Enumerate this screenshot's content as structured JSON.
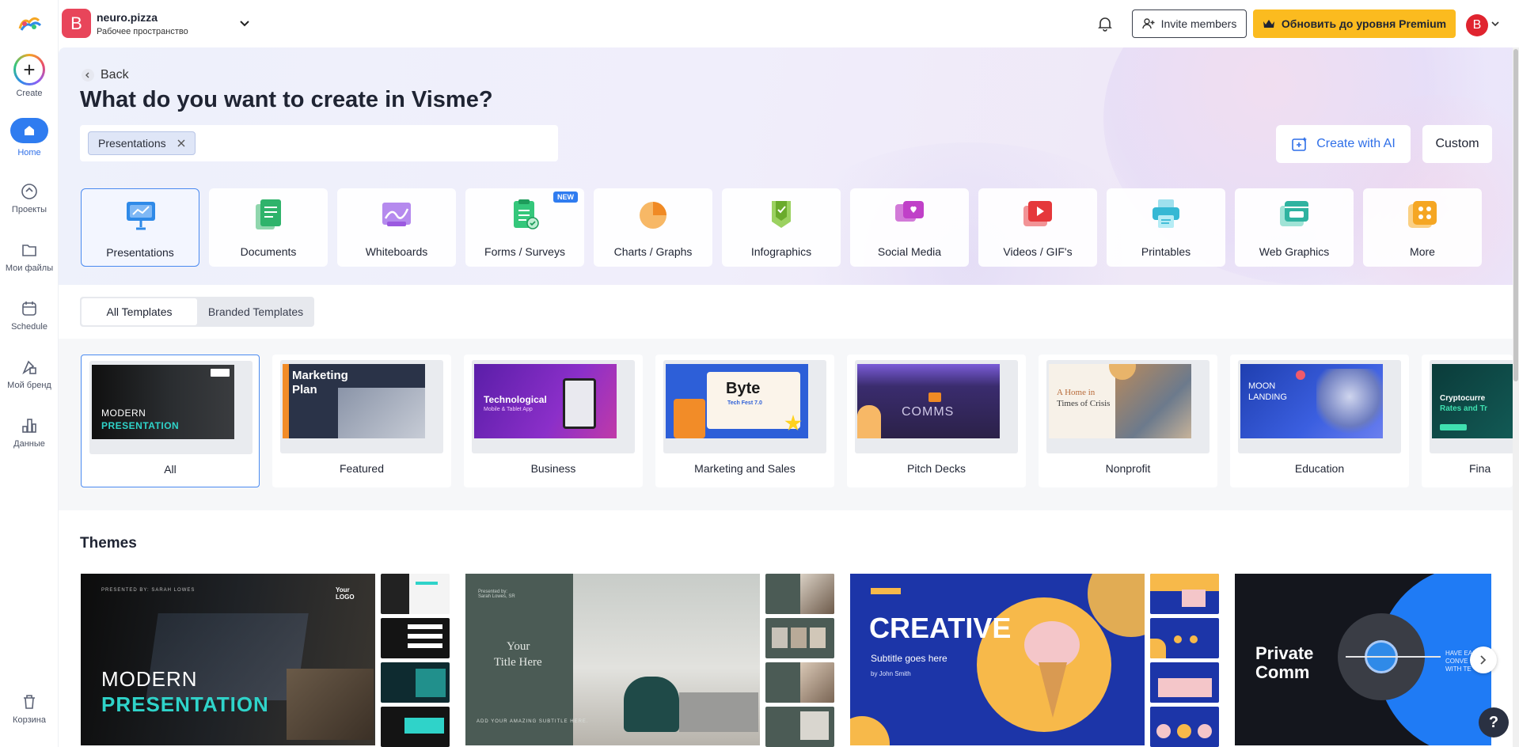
{
  "rail": {
    "items": [
      {
        "label": "Create",
        "icon": "plus-icon"
      },
      {
        "label": "Home",
        "icon": "home-icon"
      },
      {
        "label": "Проекты",
        "icon": "projects-icon"
      },
      {
        "label": "Мои файлы",
        "icon": "folder-icon"
      },
      {
        "label": "Schedule",
        "icon": "calendar-icon"
      },
      {
        "label": "Мой бренд",
        "icon": "brand-icon"
      },
      {
        "label": "Данные",
        "icon": "data-icon"
      },
      {
        "label": "Корзина",
        "icon": "trash-icon"
      }
    ]
  },
  "topbar": {
    "workspace_initial": "B",
    "workspace_name": "neuro.pizza",
    "workspace_sub": "Рабочее пространство",
    "invite_label": "Invite members",
    "premium_label": "Обновить до уровня Premium",
    "user_initial": "B"
  },
  "hero": {
    "back_label": "Back",
    "title": "What do you want to create in Visme?",
    "chip_label": "Presentations",
    "ai_label": "Create with AI",
    "custom_label": "Custom",
    "new_badge": "NEW",
    "categories": [
      {
        "label": "Presentations",
        "color": "#2f8ae8"
      },
      {
        "label": "Documents",
        "color": "#2fb36b"
      },
      {
        "label": "Whiteboards",
        "color": "#9b59e0"
      },
      {
        "label": "Forms / Surveys",
        "color": "#34c77b"
      },
      {
        "label": "Charts / Graphs",
        "color": "#f5a03a"
      },
      {
        "label": "Infographics",
        "color": "#7cbf3a"
      },
      {
        "label": "Social Media",
        "color": "#c040c8"
      },
      {
        "label": "Videos / GIF's",
        "color": "#e5383b"
      },
      {
        "label": "Printables",
        "color": "#35b8d4"
      },
      {
        "label": "Web Graphics",
        "color": "#2fb3a0"
      },
      {
        "label": "More",
        "color": "#f5a623"
      }
    ]
  },
  "templates": {
    "tab_all": "All Templates",
    "tab_branded": "Branded Templates",
    "cards": [
      {
        "label": "All",
        "thumb_line1": "MODERN",
        "thumb_line2": "PRESENTATION"
      },
      {
        "label": "Featured",
        "thumb_line1": "Marketing",
        "thumb_line2": "Plan"
      },
      {
        "label": "Business",
        "thumb_line1": "Technological",
        "thumb_line2": "Mobile & Tablet App"
      },
      {
        "label": "Marketing and Sales",
        "thumb_line1": "Byte",
        "thumb_line2": "Tech Fest 7.0"
      },
      {
        "label": "Pitch Decks",
        "thumb_line1": "COMMS",
        "thumb_line2": ""
      },
      {
        "label": "Nonprofit",
        "thumb_line1": "A Home in",
        "thumb_line2": "Times of Crisis"
      },
      {
        "label": "Education",
        "thumb_line1": "MOON",
        "thumb_line2": "LANDING"
      },
      {
        "label": "Fina",
        "thumb_line1": "Cryptocurre",
        "thumb_line2": "Rates and Tr"
      }
    ]
  },
  "themes": {
    "title": "Themes",
    "items": [
      {
        "line1": "MODERN",
        "line2": "PRESENTATION",
        "caption": "PRESENTED BY: SARAH LOWES",
        "logo": "Your LOGO"
      },
      {
        "line1": "Your",
        "line2": "Title Here",
        "caption": "ADD YOUR AMAZING SUBTITLE HERE."
      },
      {
        "line1": "CREATIVE",
        "line2": "Subtitle goes here",
        "caption": "by John Smith"
      },
      {
        "line1": "Private",
        "line2": "Comm",
        "caption": "HAVE EASY CONVE WITH TE"
      }
    ]
  }
}
